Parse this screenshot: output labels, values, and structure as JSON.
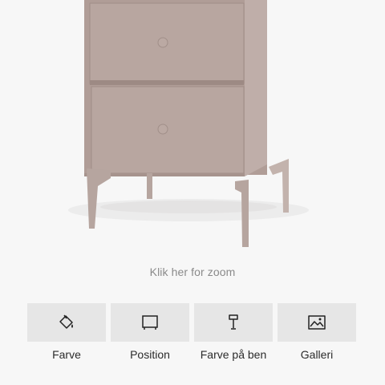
{
  "product": {
    "image_name": "nightstand-two-drawers",
    "color": "#b5a29c",
    "shadow_color": "#e9e7e6"
  },
  "zoom_hint": "Klik her for zoom",
  "options": [
    {
      "label": "Farve",
      "icon": "paint-bucket-icon"
    },
    {
      "label": "Position",
      "icon": "position-frame-icon"
    },
    {
      "label": "Farve på ben",
      "icon": "leg-icon"
    },
    {
      "label": "Galleri",
      "icon": "gallery-image-icon"
    }
  ]
}
